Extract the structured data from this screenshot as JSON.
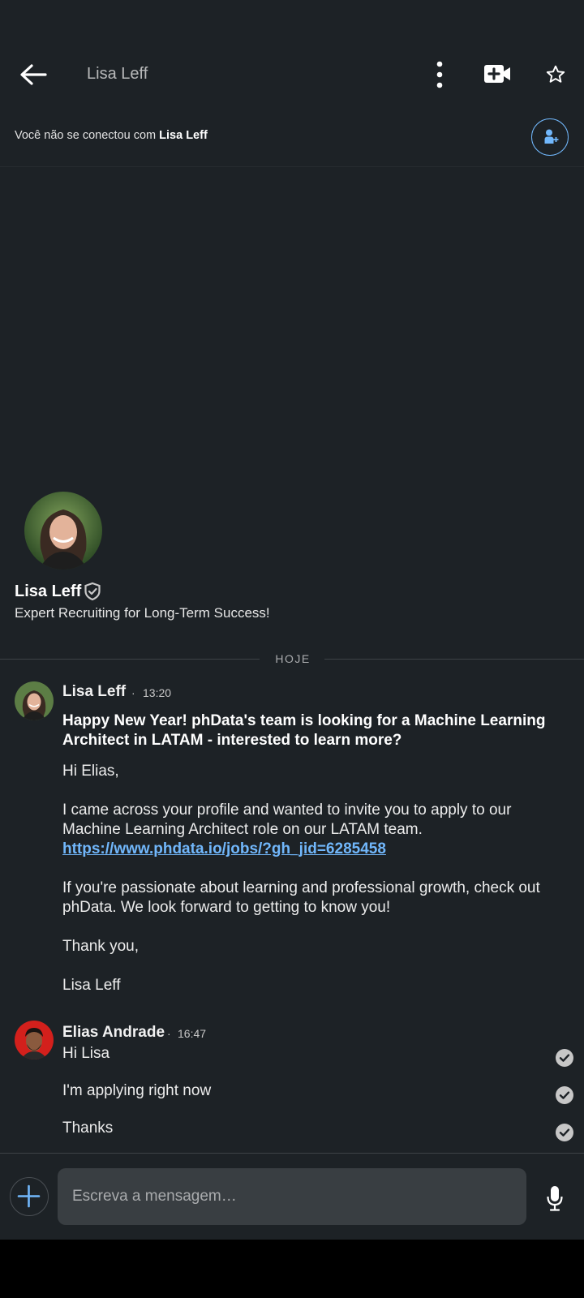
{
  "header": {
    "title": "Lisa Leff",
    "icons": [
      "back-arrow-icon",
      "more-vertical-icon",
      "video-call-icon",
      "star-icon"
    ]
  },
  "connection_banner": {
    "prefix": "Você não se conectou com ",
    "name": "Lisa Leff",
    "icon": "add-contact-icon"
  },
  "profile": {
    "name": "Lisa Leff",
    "headline": "Expert Recruiting for Long-Term Success!",
    "badge_icon": "verified-shield-icon"
  },
  "date_divider": "HOJE",
  "messages": [
    {
      "sender": "Lisa Leff",
      "separator": "·",
      "time": "13:20",
      "subject": "Happy New Year! phData's team is looking for a Machine Learning Architect in LATAM - interested to learn more?",
      "greeting": "Hi Elias,",
      "paragraph1": "I came across your profile and wanted to invite you to apply to our Machine Learning Architect role on our LATAM team.",
      "link": "https://www.phdata.io/jobs/?gh_jid=6285458",
      "paragraph2": "If you're passionate about learning and professional growth, check out phData. We look forward to getting to know you!",
      "closing": "Thank you,",
      "signature": "Lisa Leff"
    },
    {
      "sender": "Elias Andrade",
      "separator": "·",
      "time": "16:47",
      "lines": [
        "Hi Lisa",
        "I'm applying right now",
        "Thanks"
      ],
      "status_icon": "read-check-icon"
    }
  ],
  "composer": {
    "placeholder": "Escreva a mensagem…",
    "icons": [
      "plus-icon",
      "microphone-icon"
    ]
  },
  "colors": {
    "background": "#1d2226",
    "accent": "#71b7fb",
    "input_bg": "#393e42"
  }
}
